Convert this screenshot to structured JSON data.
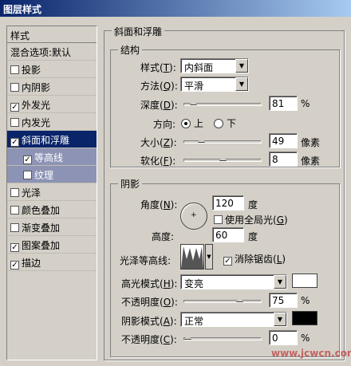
{
  "window": {
    "title": "图层样式"
  },
  "sidebar": {
    "header": "样式",
    "items": [
      {
        "label": "混合选项:默认",
        "check": null,
        "state": "normal"
      },
      {
        "label": "投影",
        "check": false,
        "state": "normal"
      },
      {
        "label": "内阴影",
        "check": false,
        "state": "normal"
      },
      {
        "label": "外发光",
        "check": true,
        "state": "normal"
      },
      {
        "label": "内发光",
        "check": false,
        "state": "normal"
      },
      {
        "label": "斜面和浮雕",
        "check": true,
        "state": "selected"
      },
      {
        "label": "等高线",
        "check": true,
        "state": "sub"
      },
      {
        "label": "纹理",
        "check": false,
        "state": "sub"
      },
      {
        "label": "光泽",
        "check": false,
        "state": "normal"
      },
      {
        "label": "颜色叠加",
        "check": false,
        "state": "normal"
      },
      {
        "label": "渐变叠加",
        "check": false,
        "state": "normal"
      },
      {
        "label": "图案叠加",
        "check": true,
        "state": "normal"
      },
      {
        "label": "描边",
        "check": true,
        "state": "normal"
      }
    ]
  },
  "bevel": {
    "title": "斜面和浮雕",
    "structure": {
      "title": "结构",
      "style_label": "样式(",
      "style_key": "T",
      "style_value": "内斜面",
      "technique_label": "方法(",
      "technique_key": "Q",
      "technique_value": "平滑",
      "depth_label": "深度(",
      "depth_key": "D",
      "depth_value": "81",
      "depth_unit": "%",
      "depth_fraction": 0.08,
      "direction_label": "方向:",
      "direction_up": "上",
      "direction_down": "下",
      "direction_selected": "up",
      "size_label": "大小(",
      "size_key": "Z",
      "size_value": "49",
      "size_unit": "像素",
      "size_fraction": 0.2,
      "soften_label": "软化(",
      "soften_key": "F",
      "soften_value": "8",
      "soften_unit": "像素",
      "soften_fraction": 0.5
    },
    "shading": {
      "title": "阴影",
      "angle_label": "角度(",
      "angle_key": "N",
      "angle_value": "120",
      "angle_unit": "度",
      "global_light_label": "使用全局光(",
      "global_light_key": "G",
      "global_light_checked": false,
      "altitude_label": "高度:",
      "altitude_value": "60",
      "altitude_unit": "度",
      "gloss_label": "光泽等高线:",
      "antialias_label": "消除锯齿(",
      "antialias_key": "L",
      "antialias_checked": true,
      "highlight_mode_label": "高光模式(",
      "highlight_mode_key": "H",
      "highlight_mode_value": "变亮",
      "highlight_color": "#ffffff",
      "highlight_opacity_label": "不透明度(",
      "highlight_opacity_key": "O",
      "highlight_opacity_value": "75",
      "highlight_opacity_unit": "%",
      "highlight_opacity_fraction": 0.75,
      "shadow_mode_label": "阴影模式(",
      "shadow_mode_key": "A",
      "shadow_mode_value": "正常",
      "shadow_color": "#000000",
      "shadow_opacity_label": "不透明度(",
      "shadow_opacity_key": "C",
      "shadow_opacity_value": "0",
      "shadow_opacity_unit": "%",
      "shadow_opacity_fraction": 0.0
    }
  },
  "watermark": {
    "text": "www.jcwcn.com"
  }
}
